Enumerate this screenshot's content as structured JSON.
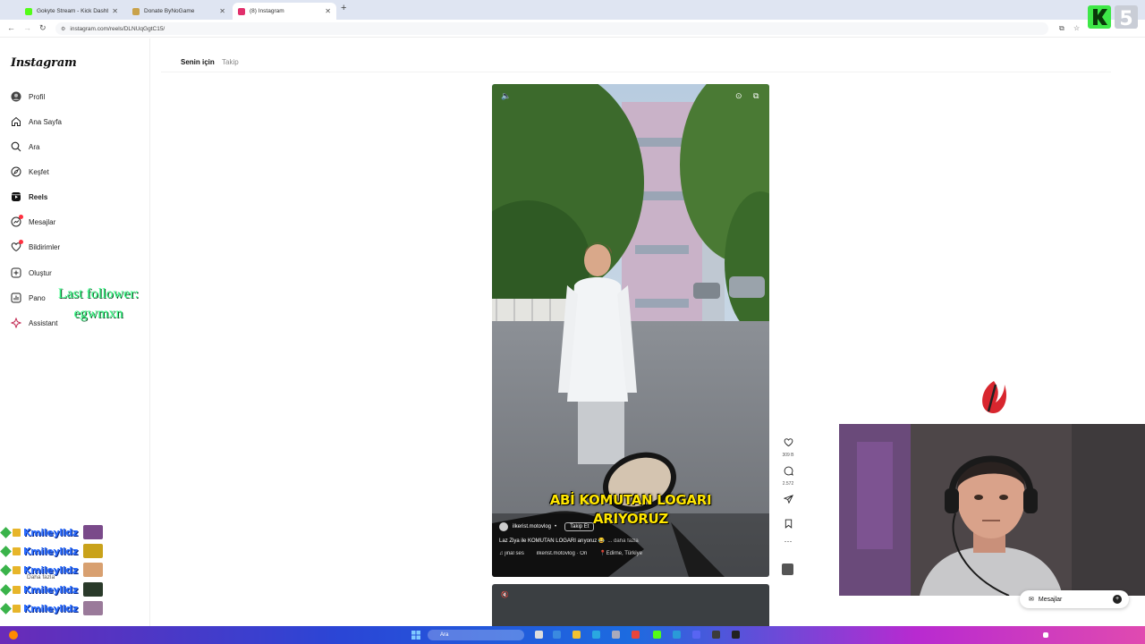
{
  "browser": {
    "tabs": [
      {
        "label": "Gokyte Stream - Kick Dashboard",
        "fav_color": "#53fc18",
        "active": false
      },
      {
        "label": "Donate ByNoGame",
        "fav_color": "#c9a24a",
        "active": false
      },
      {
        "label": "(8) Instagram",
        "fav_color": "#e1306c",
        "active": true
      }
    ],
    "url": "instagram.com/reels/DLNUqGgtC15/"
  },
  "sidebar": {
    "logo": "Instagram",
    "items": [
      {
        "label": "Profil",
        "icon": "avatar-icon"
      },
      {
        "label": "Ana Sayfa",
        "icon": "home-icon"
      },
      {
        "label": "Ara",
        "icon": "search-icon"
      },
      {
        "label": "Keşfet",
        "icon": "compass-icon"
      },
      {
        "label": "Reels",
        "icon": "reels-icon",
        "active": true
      },
      {
        "label": "Mesajlar",
        "icon": "messenger-icon",
        "badge": true
      },
      {
        "label": "Bildirimler",
        "icon": "heart-icon",
        "badge": true
      },
      {
        "label": "Oluştur",
        "icon": "plus-square-icon"
      },
      {
        "label": "Pano",
        "icon": "dashboard-icon"
      },
      {
        "label": "Assistant",
        "icon": "assistant-icon"
      }
    ]
  },
  "feed": {
    "tabs": [
      "Senin için",
      "Takip"
    ]
  },
  "reel": {
    "caption_line1": "ABİ KOMUTAN LOGARI",
    "caption_line2": "ARIYORUZ",
    "username": "ilkerist.motovlog",
    "separator": "•",
    "follow_label": "Takip Et",
    "description": "Laz Ziya ile KOMUTAN LOGARI arıyoruz 😂",
    "more_label": "... daha fazla",
    "audio": "♫ jinal ses",
    "audio_owner": "ilkerist.motovlog · Ori",
    "location": "Edirne, Türkiye"
  },
  "actions": {
    "likes": "309 B",
    "comments": "2.572"
  },
  "overlay": {
    "last_follower_label": "Last follower:",
    "last_follower_name": "egwmxn",
    "dm_label": "Mesajlar"
  },
  "chat": {
    "rows": [
      {
        "user": "Kmileylldz",
        "emote_color": "#7a4a8a"
      },
      {
        "user": "Kmileylldz",
        "emote_color": "#c9a21a"
      },
      {
        "user": "Kmileylldz",
        "emote_color": "#d8a070"
      },
      {
        "user": "Kmileylldz",
        "emote_color": "#2a3a2a"
      },
      {
        "user": "Kmileylldz",
        "emote_color": "#9a7a9a"
      }
    ],
    "more_label": "Daha fazla"
  },
  "taskbar": {
    "search_placeholder": "Ara"
  },
  "colors": {
    "caption": "#ffe600",
    "follower_text": "#3aff88",
    "chat_user": "#2a6cff",
    "notification": "#ff3040"
  }
}
